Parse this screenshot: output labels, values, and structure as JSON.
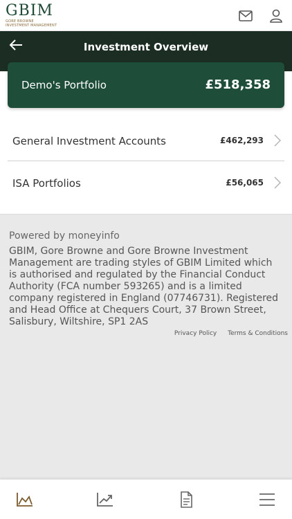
{
  "header": {
    "brand": "GBIM",
    "brand_sub_1": "GORE BROWNE",
    "brand_sub_2": "INVESTMENT MANAGEMENT",
    "icons": [
      "mail-icon",
      "user-icon"
    ]
  },
  "titlebar": {
    "title": "Investment Overview",
    "back_icon": "arrow-left-icon"
  },
  "portfolio": {
    "name": "Demo's Portfolio",
    "total": "£518,358"
  },
  "accounts": [
    {
      "label": "General Investment Accounts",
      "amount": "£462,293"
    },
    {
      "label": "ISA Portfolios",
      "amount": "£56,065"
    }
  ],
  "footer": {
    "powered_by": "Powered by moneyinfo",
    "legal": "GBIM, Gore Browne and Gore Browne Investment Management are trading styles of GBIM Limited which is authorised and regulated by the Financial Conduct Authority (FCA number 593265) and is a limited company registered in England (07746731). Registered and Head Office at Chequers Court, 37 Brown Street, Salisbury, Wiltshire, SP1 2AS",
    "privacy_link": "Privacy Policy",
    "terms_link": "Terms & Conditions"
  },
  "bottom_nav": {
    "items": [
      "area-chart-icon",
      "trend-chart-icon",
      "document-icon",
      "menu-icon"
    ],
    "active_color": "#7a5a2c",
    "inactive_color": "#666666"
  },
  "colors": {
    "dark_green": "#1c2e24",
    "card_green": "#1e4d3a",
    "brand_green": "#1f4a36"
  }
}
